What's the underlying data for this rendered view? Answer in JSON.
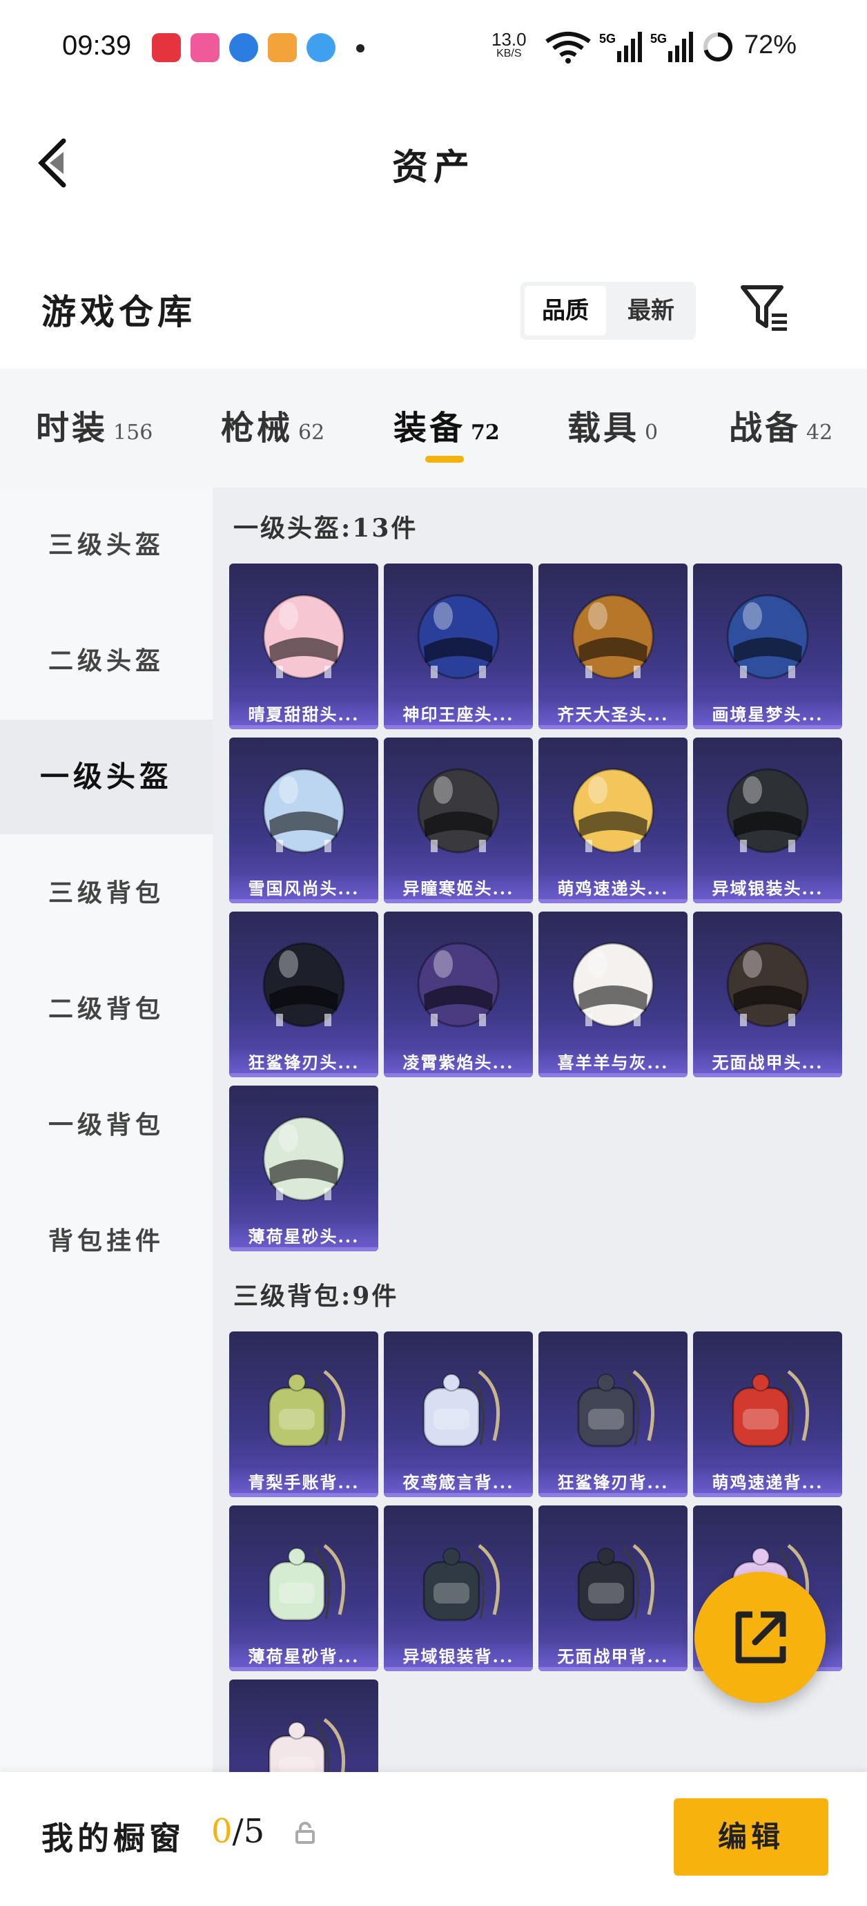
{
  "status_bar": {
    "time": "09:39",
    "net_speed": "13.0",
    "net_unit": "KB/S",
    "signal_label_1": "5G",
    "signal_label_2": "5G",
    "battery": "72%"
  },
  "header": {
    "title": "资产"
  },
  "warehouse": {
    "title": "游戏仓库",
    "sort_quality": "品质",
    "sort_newest": "最新"
  },
  "tabs": [
    {
      "label": "时装",
      "count": "156"
    },
    {
      "label": "枪械",
      "count": "62"
    },
    {
      "label": "装备",
      "count": "72"
    },
    {
      "label": "载具",
      "count": "0"
    },
    {
      "label": "战备",
      "count": "42"
    }
  ],
  "sidebar": {
    "items": [
      {
        "label": "三级头盔"
      },
      {
        "label": "二级头盔"
      },
      {
        "label": "一级头盔"
      },
      {
        "label": "三级背包"
      },
      {
        "label": "二级背包"
      },
      {
        "label": "一级背包"
      },
      {
        "label": "背包挂件"
      }
    ]
  },
  "sections": [
    {
      "title": "一级头盔:13件",
      "items": [
        {
          "label": "晴夏甜甜头...",
          "color": "#f6c6d3"
        },
        {
          "label": "神印王座头...",
          "color": "#2a3f9a"
        },
        {
          "label": "齐天大圣头...",
          "color": "#b7772b"
        },
        {
          "label": "画境星梦头...",
          "color": "#2d4f9e"
        },
        {
          "label": "雪国风尚头...",
          "color": "#bcd6f2"
        },
        {
          "label": "异瞳寒姬头...",
          "color": "#3a3a3e"
        },
        {
          "label": "萌鸡速递头...",
          "color": "#f2c65a"
        },
        {
          "label": "异域银装头...",
          "color": "#2d3136"
        },
        {
          "label": "狂鲨锋刃头...",
          "color": "#1d1f2a"
        },
        {
          "label": "凌霄紫焰头...",
          "color": "#4a3a80"
        },
        {
          "label": "喜羊羊与灰...",
          "color": "#f4f1ee"
        },
        {
          "label": "无面战甲头...",
          "color": "#3e3430"
        },
        {
          "label": "薄荷星砂头...",
          "color": "#dbe9d8"
        }
      ]
    },
    {
      "title": "三级背包:9件",
      "items": [
        {
          "label": "青梨手账背...",
          "color": "#b9c86e"
        },
        {
          "label": "夜鸢箴言背...",
          "color": "#d8dff2"
        },
        {
          "label": "狂鲨锋刃背...",
          "color": "#404454"
        },
        {
          "label": "萌鸡速递背...",
          "color": "#d23a2e"
        },
        {
          "label": "薄荷星砂背...",
          "color": "#d6ecd2"
        },
        {
          "label": "异域银装背...",
          "color": "#2f3a44"
        },
        {
          "label": "无面战甲背...",
          "color": "#2c2f3a"
        },
        {
          "label": "",
          "color": "#e4c7f0"
        },
        {
          "label": "",
          "color": "#f3e6e8"
        }
      ]
    }
  ],
  "bottom": {
    "label": "我的橱窗",
    "current": "0",
    "total": "/5",
    "edit": "编辑"
  }
}
